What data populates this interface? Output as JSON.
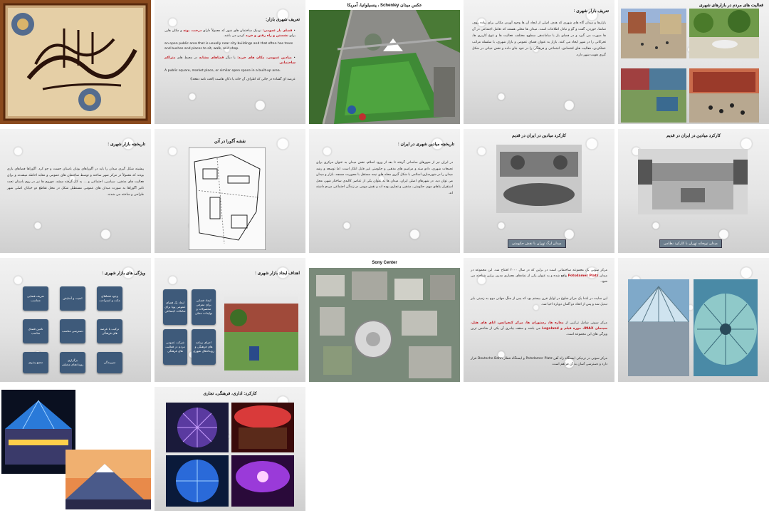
{
  "slides": [
    {
      "id": 1,
      "kind": "calligraphy",
      "calligraphy": "بسم الله الرحمن الرحیم"
    },
    {
      "id": 2,
      "title": "تعریف شهری بازار:",
      "p1a": "فضای باز عمومی:",
      "p1b": " نزدیک ساختمان های شهر که معمولاً دارای ",
      "p1c": "درخت، بوته",
      "p1d": " و مکان هایی برای ",
      "p1e": "نشستن و راه رفتن و خرید",
      "p1f": " کردن می باشد.",
      "en1": "an open public area that is usually near city buildings and that often has trees and bushes and places to sit, walk, and shop.",
      "p2a": "میادین عمومی، مکان های خرید:",
      "p2b": " یا دیگر ",
      "p2c": "فضاهای مشابه",
      "p2d": " در محیط های ",
      "p2e": "متراکم ساختمانی",
      "en2": "A public square, market place, or similar open space in a built-up area.",
      "p3": "عرصه ای گشاده در جائی که اطراف آن خانه یا دکان هاست (لغت نامه دهخدا)"
    },
    {
      "id": 3,
      "title": "عکس میدان Schenley ، پنسیلوانیا، آمریکا"
    },
    {
      "id": 4,
      "title": "تعریف بازار شهری :",
      "text": "بازارها و میدان گاه های شهری که هدف اصلی از ایجاد آن ها وجود آوردن مکانی برای پیاده روی، تماشا، خوردن، گفت و گو و تبادل اطلاعات است. میدان ها محلی هستند که تعامل اجتماعی در آن ها صورت می گیرد و در فضای باز با ساماندهی سطوح مختلف، فعالیت ها و تنوع کاربری ها، تحرکاتی را در شهر ایجاد می کنند. بازار به عنوان فضای عمومی و بازار شهری، با سلسله مراتب عملکردی، فعالیت های اقتصادی، اجتماعی و فرهنگی را در خود جای داده و نقش حیاتی در شکل گیری هویت شهر دارد."
    },
    {
      "id": 5,
      "title": "فعالیت های مردم در بازارهای شهری"
    },
    {
      "id": 6,
      "title": "تاریخچه بازار شهری :",
      "text": "پیشینه شکل گیری میدان را باید در آگوراهای یونان باستان جست و جو کرد. آگوراها فضاهای بازی بودند که معمولاً در مرکز شهر ساخته و توسط ساختمان های عمومی و معابد احاطه میشدند و برای فعالیت های مذهبی، سیاسی، اجتماعی و ... به کار گرفته میشد. فوروم ها نیز در روم باستان تحت تاثیر آگوراها به صورت میدان های عمومی مستطیل شکل در محل تقاطع دو خیابان اصلی شهر طراحی و ساخته می شدند."
    },
    {
      "id": 7,
      "title": "نقشه آگورا در آتن"
    },
    {
      "id": 8,
      "title": "تاریخچه میادین شهری در ایران :",
      "text": "در ایران نیز از شهرهای ساسانی گرفته تا بعد از ورود اسلام، نقش میدان به عنوان مرکزی برای تجمعات شهری، دادو ستد و مراسم های مذهبی و حکومتی غیر قابل انکار است. اما توسعه و رشد میدان را در شهرسازی اسلامی با شکل گیری محله های نیمه مستقل با محوریت مسجد، بازار و میدان می توان دید. در شهرهای اصلی ایران، میدان ها به عنوان یکی از عناصر کالبدی ساختار شهر، محل استقرار بناهای مهم، حکومتی، مذهبی و تجاری بوده اند و نقش مهمی در زندگی اجتماعی مردم داشته اند."
    },
    {
      "id": 9,
      "title": "کارکرد میادین در ایران در قدیم",
      "caption": "میدان ارگ تهران با نقش حکومتی"
    },
    {
      "id": 10,
      "title": "کارکرد میادین در ایران در قدیم",
      "caption": "میدان توپخانه تهران با کارکرد نظامی"
    },
    {
      "id": 11,
      "title": "ویژگی های بازار شهری :",
      "cells": [
        "تعریف فضایی متناسب",
        "امنیت و آسایش",
        "وجود فضاهای مکث و استراحت",
        "تامین فضای مناسب",
        "دسترسی مناسب",
        "ترکیب با عرصه های فرهنگی",
        "تجمع پذیری",
        "برگزاری رویدادهای مختلف",
        "سرزندگی"
      ]
    },
    {
      "id": 12,
      "title": "اهداف ایجاد بازار شهری :",
      "cells": [
        "ایجاد یک فضای عمومی پویا برای تعاملات اجتماعی",
        "ایجاد فضایی برای معرفی محصولات و تولیدات محلی",
        "شرکت عمومی مردم در فعالیت های فرهنگی",
        "اجرای برنامه های فرهنگی و رویدادهای شهری"
      ]
    },
    {
      "id": 13,
      "title": "Sony Center"
    },
    {
      "id": 14,
      "text1a": "مرکز سونی یک مجموعه ساختمانی است در برلین که در سال ۲۰۰۰ افتتاح شد. این مجموعه در میدان ",
      "text1b": "Potsdamer Platz",
      "text1c": " واقع شده و به عنوان یکی از نمادهای معماری مدرن برلین شناخته می شود.",
      "text2": "این سایت در ابتدا یک مرکز شلوغ در اوایل قرن بیستم بود که پس از جنگ جهانی دوم به زمینی بایر تبدیل شد و پس از اتحاد دو آلمان دوباره احیا شد.",
      "text3a": "مرکز سونی شامل ترکیبی از ",
      "text3b": "مغازه ها، رستوران ها، مرکز کنفرانس، اتاق های هتل، سینمای IMAX، موزه فیلم و Legoland",
      "text3c": " می باشد و سقف چادری آن یکی از شاخص ترین ویژگی های این مجموعه است.",
      "text4": "مرکز سونی در نزدیکی ایستگاه راه آهن Potsdamer Platz و ایستگاه قطار Deutsche Bahn قرار دارد و دسترسی آسان به آن فراهم است."
    },
    {
      "id": 15,
      "kind": "photos"
    },
    {
      "id": 16,
      "kind": "photos"
    },
    {
      "id": 17,
      "title": "کارکرد: اداری، فرهنگی، تجاری"
    }
  ]
}
